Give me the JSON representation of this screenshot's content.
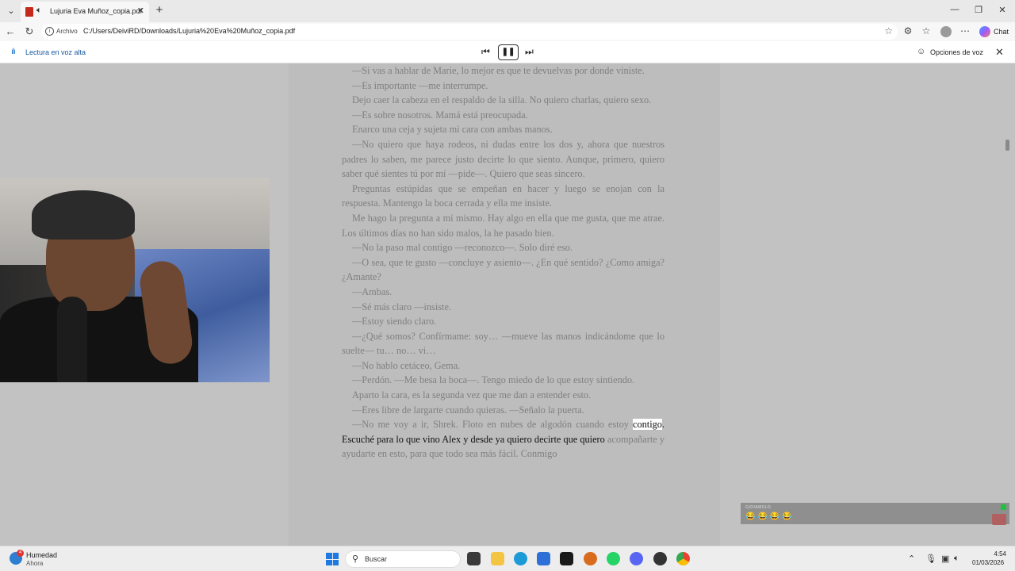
{
  "browser": {
    "tab_title": "Lujuria Eva Muñoz_copia.pdf",
    "address_scheme": "Archivo",
    "address_url": "C:/Users/DeiviRD/Downloads/Lujuria%20Eva%20Muñoz_copia.pdf",
    "chat_label": "Chat"
  },
  "read_aloud": {
    "label": "Lectura en voz alta",
    "voice_options": "Opciones de voz"
  },
  "document": {
    "paragraphs": [
      {
        "text": "—Si vas a hablar de Marie, lo mejor es que te devuelvas por donde viniste."
      },
      {
        "text": "—Es importante —me interrumpe."
      },
      {
        "text": "Dejo caer la cabeza en el respaldo de la silla. No quiero charlas, quiero sexo."
      },
      {
        "text": "—Es sobre nosotros. Mamá está preocupada."
      },
      {
        "text": "Enarco una ceja y sujeta mi cara con ambas manos."
      },
      {
        "text": "—No quiero que haya rodeos, ni dudas entre los dos y, ahora que nuestros padres lo saben, me parece justo decirte lo que siento. Aunque, primero, quiero saber qué sientes tú por mí —pide—. Quiero que seas sincero."
      },
      {
        "text": "Preguntas estúpidas que se empeñan en hacer y luego se enojan con la respuesta. Mantengo la boca cerrada y ella me insiste."
      },
      {
        "text": "Me hago la pregunta a mí mismo. Hay algo en ella que me gusta, que me atrae. Los últimos días no han sido malos, la he pasado bien."
      },
      {
        "text": "—No la paso mal contigo —reconozco—. Solo diré eso."
      },
      {
        "text": "—O sea, que te gusto —concluye y asiento—. ¿En qué sentido? ¿Como amiga? ¿Amante?"
      },
      {
        "text": "—Ambas."
      },
      {
        "text": "—Sé más claro —insiste."
      },
      {
        "text": "—Estoy siendo claro."
      },
      {
        "text": "—¿Qué somos? Confírmame: soy… —mueve las manos indicándome que lo suelte— tu… no… vi…"
      },
      {
        "text": "—No hablo cetáceo, Gema."
      },
      {
        "text": "—Perdón. —Me besa la boca—. Tengo miedo de lo que estoy sintiendo."
      },
      {
        "text": "Aparto la cara, es la segunda vez que me dan a entender esto."
      },
      {
        "text": "—Eres libre de largarte cuando quieras. —Señalo la puerta."
      }
    ],
    "last_paragraph_start": "—No me voy a ir, Shrek. Floto en nubes de algodón cuando estoy ",
    "highlighted_word": "contigo",
    "active_sentence": ". Escuché para lo que vino Alex y desde ya quiero decirte que quiero",
    "last_paragraph_end": " acompañarte y ayudarte en esto, para que todo sea más fácil. Conmigo"
  },
  "overlay": {
    "username": "GIDIAMSLO",
    "emojis": "😂😂😂😂"
  },
  "taskbar": {
    "weather_title": "Humedad",
    "weather_sub": "Ahora",
    "weather_badge": "4",
    "search_label": "Buscar",
    "time": "4:54",
    "date": "01/03/2026"
  }
}
